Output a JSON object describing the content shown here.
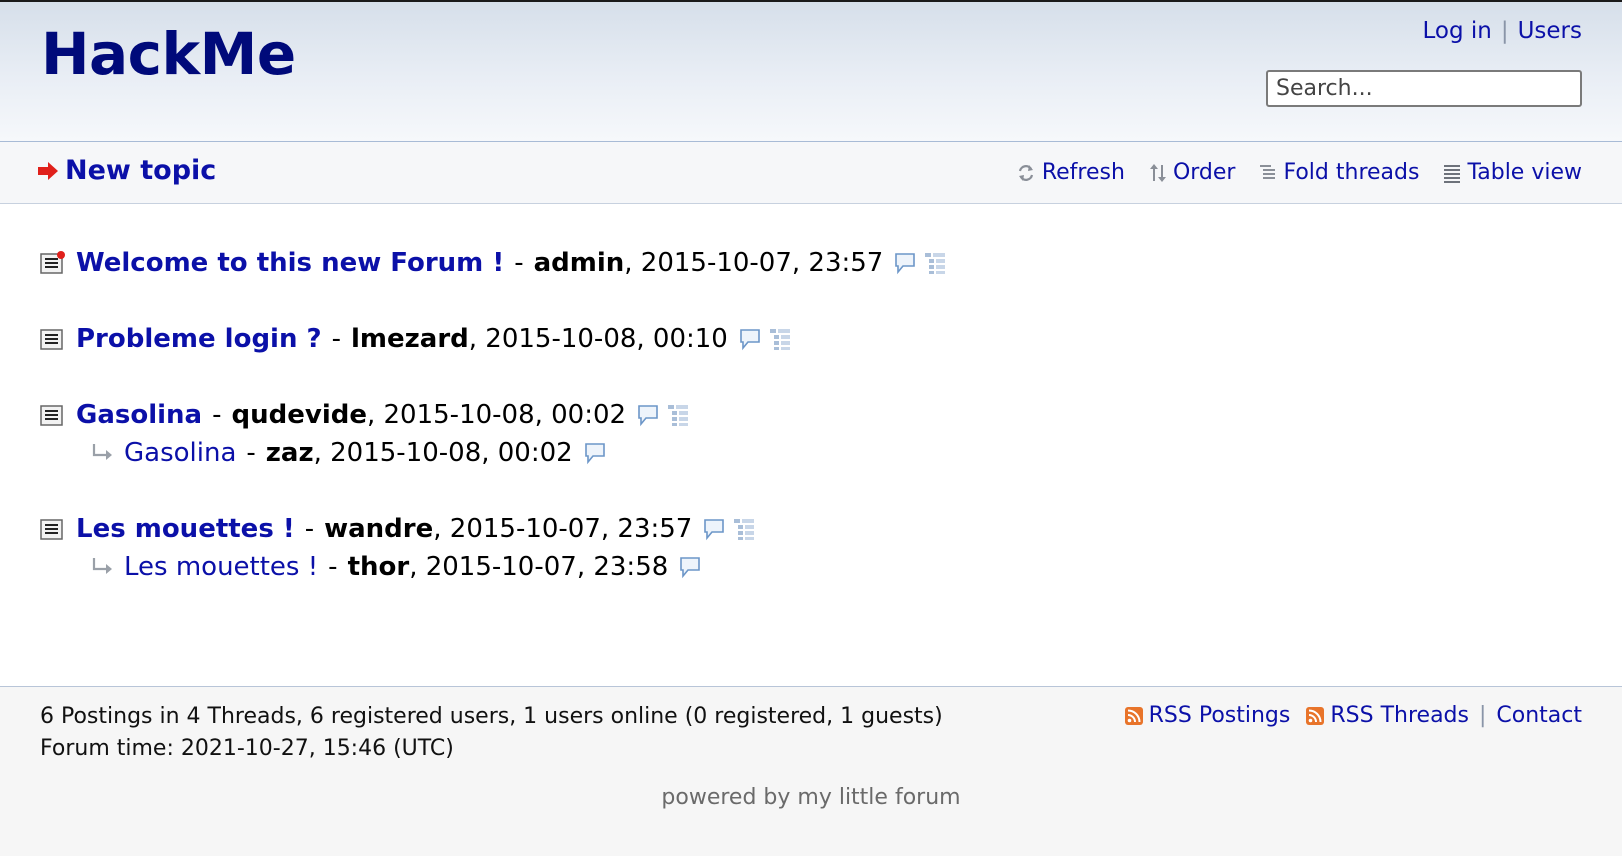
{
  "header": {
    "logo": "HackMe",
    "login_label": "Log in",
    "users_label": "Users",
    "separator": "|",
    "search_placeholder": "Search..."
  },
  "subnav": {
    "new_topic_label": "New topic",
    "refresh_label": "Refresh",
    "order_label": "Order",
    "fold_threads_label": "Fold threads",
    "table_view_label": "Table view"
  },
  "threads": [
    {
      "title": "Welcome to this new Forum !",
      "author": "admin",
      "date": "2015-10-07, 23:57",
      "new": true,
      "replies": []
    },
    {
      "title": "Probleme login ?",
      "author": "lmezard",
      "date": "2015-10-08, 00:10",
      "new": false,
      "replies": []
    },
    {
      "title": "Gasolina",
      "author": "qudevide",
      "date": "2015-10-08, 00:02",
      "new": false,
      "replies": [
        {
          "title": "Gasolina",
          "author": "zaz",
          "date": "2015-10-08, 00:02"
        }
      ]
    },
    {
      "title": "Les mouettes !",
      "author": "wandre",
      "date": "2015-10-07, 23:57",
      "new": false,
      "replies": [
        {
          "title": "Les mouettes !",
          "author": "thor",
          "date": "2015-10-07, 23:58"
        }
      ]
    }
  ],
  "footer": {
    "stats_line": "6 Postings in 4 Threads, 6 registered users, 1 users online (0 registered, 1 guests)",
    "forum_time": "Forum time: 2021-10-27, 15:46 (UTC)",
    "rss_postings_label": "RSS Postings",
    "rss_threads_label": "RSS Threads",
    "contact_label": "Contact",
    "separator": "|",
    "powered_by": "powered by my little forum"
  },
  "icons": {
    "new_topic": "red-arrow-icon",
    "refresh": "refresh-icon",
    "order": "order-icon",
    "fold": "fold-threads-icon",
    "table": "table-view-icon",
    "thread": "thread-document-icon",
    "reply": "reply-arrow-icon",
    "speech": "speech-bubble-icon",
    "tree": "thread-tree-icon",
    "rss": "rss-icon"
  },
  "colors": {
    "link": "#0b10a8",
    "logo": "#000a7a",
    "new_dot": "#e0201b",
    "rss": "#e8742a"
  }
}
